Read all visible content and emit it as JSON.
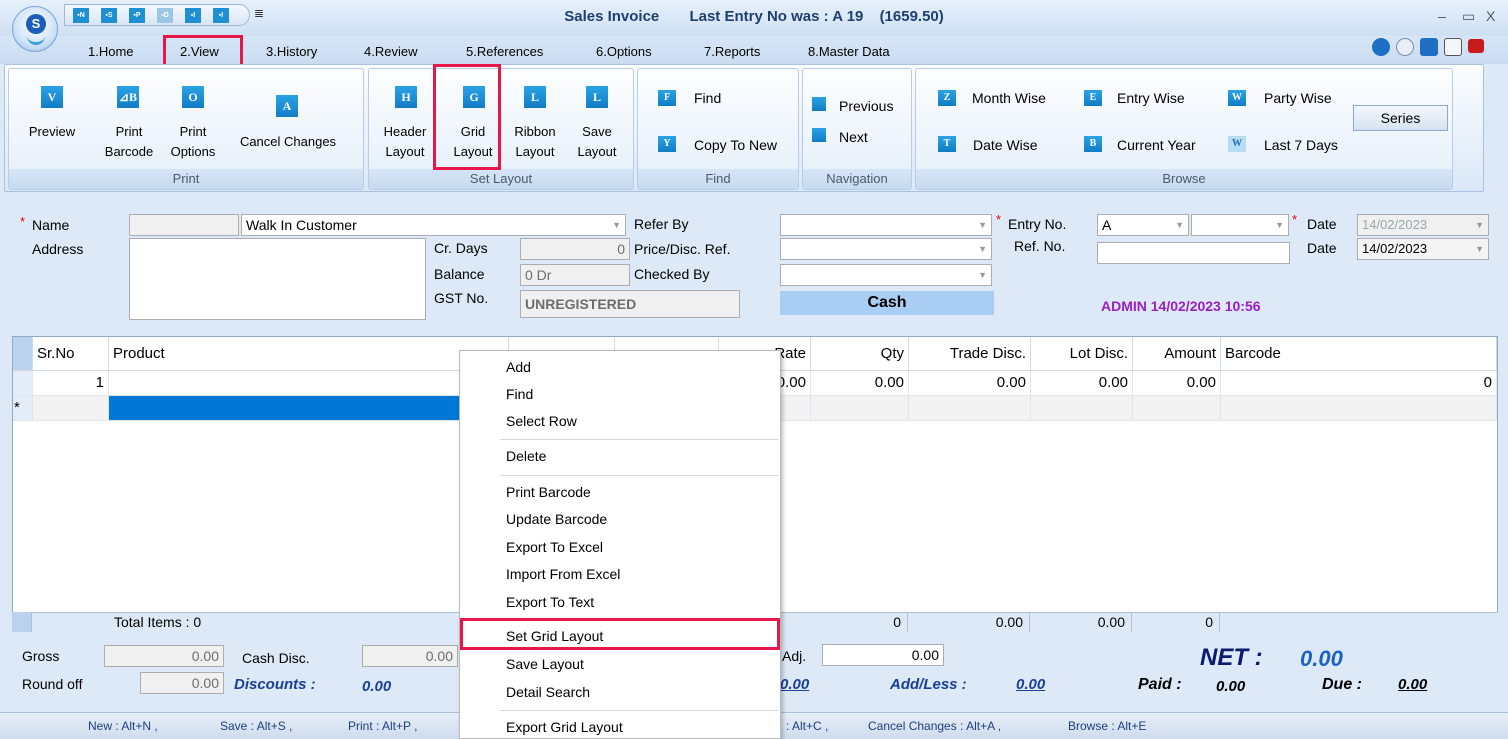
{
  "window": {
    "app_title": "Sales Invoice",
    "last_entry": "Last Entry No was : A 19",
    "last_amount": "(1659.50)",
    "qat_menu": "≣",
    "minimize": "–",
    "maximize": "▭",
    "close": "X",
    "logo": "S"
  },
  "qat": [
    "▪N",
    "▪S",
    "▪P",
    "▪D",
    "▪I",
    "▪I"
  ],
  "menu": [
    "1.Home",
    "2.View",
    "3.History",
    "4.Review",
    "5.References",
    "6.Options",
    "7.Reports",
    "8.Master Data"
  ],
  "ribbon": {
    "print": {
      "footer": "Print",
      "preview_icon": "V",
      "preview_l1": "Preview",
      "barcode_icon": "⊿B",
      "barcode_l1": "Print",
      "barcode_l2": "Barcode",
      "options_icon": "O",
      "options_l1": "Print",
      "options_l2": "Options",
      "cancel_icon": "A",
      "cancel_l1": "Cancel Changes"
    },
    "layout": {
      "footer": "Set Layout",
      "header_icon": "H",
      "header_l1": "Header",
      "header_l2": "Layout",
      "grid_icon": "G",
      "grid_l1": "Grid",
      "grid_l2": "Layout",
      "ribbon_icon": "L",
      "ribbon_l1": "Ribbon",
      "ribbon_l2": "Layout",
      "save_icon": "L",
      "save_l1": "Save",
      "save_l2": "Layout"
    },
    "find": {
      "footer": "Find",
      "find_icon": "F",
      "find_l": "Find",
      "copy_icon": "Y",
      "copy_l": "Copy To New"
    },
    "nav": {
      "footer": "Navigation",
      "prev_l": "Previous",
      "next_l": "Next"
    },
    "browse": {
      "footer": "Browse",
      "month_icon": "Z",
      "month": "Month Wise",
      "entry_icon": "E",
      "entry": "Entry Wise",
      "party_icon": "W",
      "party": "Party Wise",
      "date_icon": "T",
      "date": "Date Wise",
      "cy_icon": "B",
      "cy": "Current Year",
      "l7_icon": "W",
      "l7": "Last 7 Days",
      "series": "Series"
    }
  },
  "form": {
    "name_label": "Name",
    "address_label": "Address",
    "name_value": "Walk In Customer",
    "crdays_label": "Cr. Days",
    "crdays_value": "0",
    "balance_label": "Balance",
    "balance_value": "0 Dr",
    "gst_label": "GST No.",
    "gst_value": "UNREGISTERED",
    "referby_label": "Refer By",
    "pricedisc_label": "Price/Disc. Ref.",
    "checkedby_label": "Checked By",
    "cash": "Cash",
    "entryno_label": "Entry No.",
    "entryno_value": "A",
    "refno_label": "Ref. No.",
    "date1_label": "Date",
    "date1_value": "14/02/2023",
    "date2_label": "Date",
    "date2_value": "14/02/2023",
    "admin": "ADMIN 14/02/2023 10:56"
  },
  "grid": {
    "headers": [
      "Sr.No",
      "Product",
      "Rate",
      "Qty",
      "Trade Disc.",
      "Lot Disc.",
      "Amount",
      "Barcode"
    ],
    "row1": {
      "srno": "1",
      "rate": "0.00",
      "qty": "0.00",
      "trade": "0.00",
      "lot": "0.00",
      "amount": "0.00",
      "last": "0"
    },
    "new_row_marker": "*",
    "total_items": "Total Items : 0",
    "totals": {
      "qty": "0",
      "trade": "0.00",
      "lot": "0.00",
      "amount": "0"
    }
  },
  "summary": {
    "gross_label": "Gross",
    "gross_value": "0.00",
    "cashdisc_label": "Cash Disc.",
    "cashdisc_value": "0.00",
    "roundoff_label": "Round off",
    "roundoff_value": "0.00",
    "discounts_label": "Discounts :",
    "discounts_value": "0.00",
    "adj_label": "Adj.",
    "adj_value": "0.00",
    "mid_value": "0.00",
    "addless_label": "Add/Less :",
    "addless_value": "0.00",
    "net_label": "NET :",
    "net_value": "0.00",
    "paid_label": "Paid :",
    "paid_value": "0.00",
    "due_label": "Due :",
    "due_value": "0.00"
  },
  "status": [
    "New : Alt+N ,",
    "Save : Alt+S ,",
    "Print : Alt+P ,",
    ": Alt+C ,",
    "Cancel Changes : Alt+A ,",
    "Browse : Alt+E"
  ],
  "context_menu": [
    "Add",
    "Find",
    "Select Row",
    "Delete",
    "Print Barcode",
    "Update Barcode",
    "Export To Excel",
    "Import From Excel",
    "Export To Text",
    "Set Grid Layout",
    "Save Layout",
    "Detail Search",
    "Export Grid Layout"
  ],
  "colors": {
    "highlight": "#e8174a",
    "accent": "#1a80cc",
    "admin": "#9a1ec8"
  }
}
